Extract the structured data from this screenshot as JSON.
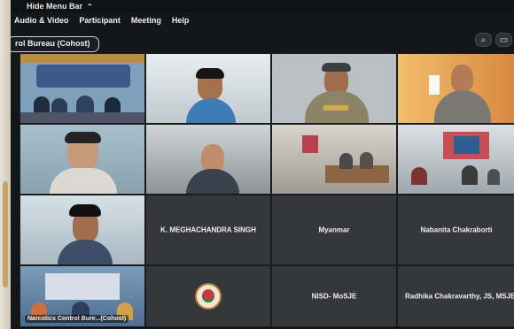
{
  "window": {
    "hide_menu_label": "Hide Menu Bar",
    "hide_menu_icon": "chevron-up-icon"
  },
  "menu": {
    "items": [
      "Audio & Video",
      "Participant",
      "Meeting",
      "Help"
    ]
  },
  "cohost_badge": "rol Bureau (Cohost)",
  "toolbar": {
    "icons": [
      "view-icon",
      "screen-share-icon"
    ]
  },
  "participants": [
    {
      "name": "",
      "type": "video"
    },
    {
      "name": "",
      "type": "video"
    },
    {
      "name": "",
      "type": "video"
    },
    {
      "name": "",
      "type": "video"
    },
    {
      "name": "",
      "type": "video"
    },
    {
      "name": "",
      "type": "video"
    },
    {
      "name": "",
      "type": "video"
    },
    {
      "name": "",
      "type": "video"
    },
    {
      "name": "",
      "type": "video"
    },
    {
      "name": "K. MEGHACHANDRA SINGH",
      "type": "name"
    },
    {
      "name": "Myanmar",
      "type": "name"
    },
    {
      "name": "Nabanita Chakraborti",
      "type": "name"
    },
    {
      "name": "Narcotics Control Bure...(Cohost)",
      "type": "video"
    },
    {
      "name": "",
      "type": "logo"
    },
    {
      "name": "NISD- MoSJE",
      "type": "name"
    },
    {
      "name": "Radhika Chakravarthy, JS, MSJE",
      "type": "name"
    }
  ]
}
